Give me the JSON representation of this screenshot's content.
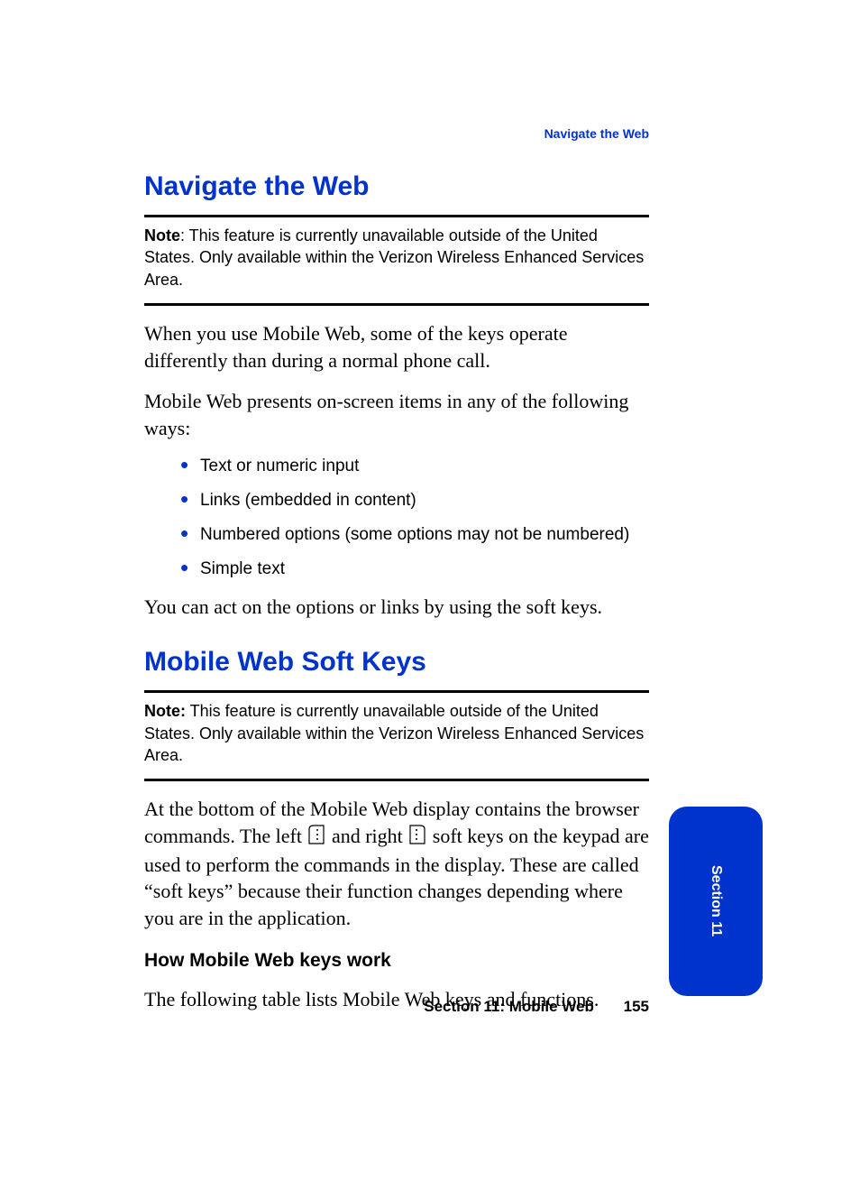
{
  "running_head": "Navigate the Web",
  "section1": {
    "title": "Navigate the Web",
    "note_label": "Note",
    "note_text": ": This feature is currently unavailable outside of the United States. Only available within the Verizon Wireless Enhanced Services Area.",
    "p1": "When you use Mobile Web, some of the keys operate differently than during a normal phone call.",
    "p2": "Mobile Web presents on-screen items in any of the following ways:",
    "bullets": [
      "Text or numeric input",
      "Links (embedded in content)",
      "Numbered options (some options may not be numbered)",
      "Simple text"
    ],
    "p3": "You can act on the options or links by using the soft keys."
  },
  "section2": {
    "title": "Mobile Web Soft Keys",
    "note_label": "Note:",
    "note_text": " This feature is currently unavailable outside of the United States. Only available within the Verizon Wireless Enhanced Services Area.",
    "p1_a": "At the bottom of the Mobile Web display contains the browser commands. The left ",
    "p1_b": " and right ",
    "p1_c": " soft keys on the keypad are used to perform the commands in the display. These are called “soft keys” because their function changes depending where you are in the application.",
    "sub_heading": "How Mobile Web keys work",
    "p2": "The following table lists Mobile Web keys and functions."
  },
  "footer": {
    "section_label": "Section 11: Mobile Web",
    "page_number": "155"
  },
  "side_tab": "Section 11"
}
